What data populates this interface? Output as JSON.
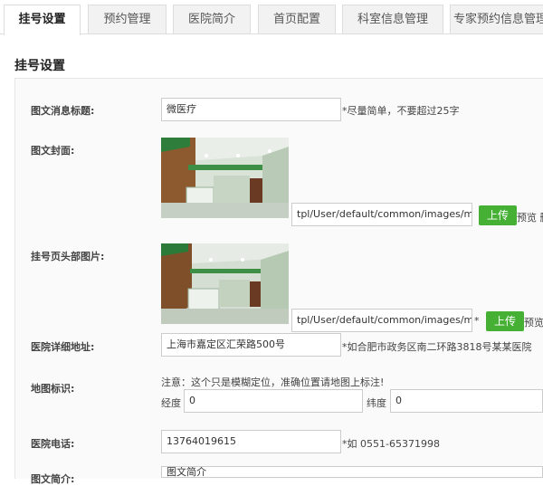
{
  "tabs": [
    {
      "label": "挂号设置",
      "active": true
    },
    {
      "label": "预约管理",
      "active": false
    },
    {
      "label": "医院简介",
      "active": false
    },
    {
      "label": "首页配置",
      "active": false
    },
    {
      "label": "科室信息管理",
      "active": false
    },
    {
      "label": "专家预约信息管理",
      "active": false
    }
  ],
  "page_title": "挂号设置",
  "form": {
    "title_label": "图文消息标题:",
    "title_value": "微医疗",
    "title_hint": "*尽量简单，不要超过25字",
    "cover_label": "图文封面:",
    "cover_path": "tpl/User/default/common/images/m",
    "cover_upload": "上传",
    "cover_preview": "预览 删除",
    "header_label": "挂号页头部图片:",
    "header_path": "tpl/User/default/common/images/m",
    "header_star": "*",
    "header_upload": "上传",
    "header_preview": "预览",
    "address_label": "医院详细地址:",
    "address_value": "上海市嘉定区汇荣路500号",
    "address_hint": "*如合肥市政务区南二环路3818号某某医院",
    "map_label": "地图标识:",
    "map_note": "注意：这个只是模糊定位，准确位置请地图上标注!",
    "lng_label": "经度",
    "lng_value": "0",
    "lat_label": "纬度",
    "lat_value": "0",
    "phone_label": "医院电话:",
    "phone_value": "13764019615",
    "phone_hint": "*如 0551-65371998",
    "intro_label": "图文简介:",
    "intro_value": "图文简介"
  }
}
